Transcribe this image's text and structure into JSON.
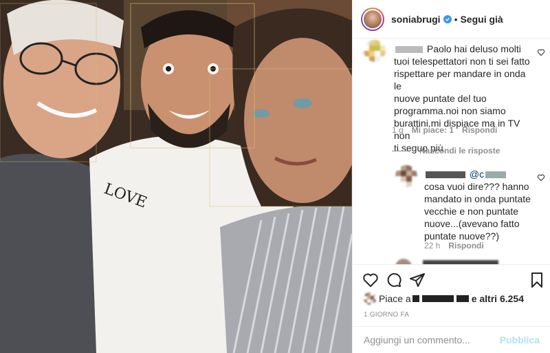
{
  "post": {
    "username": "soniabrugi",
    "follow_label": "Segui già",
    "separator": "•"
  },
  "comments": [
    {
      "text_line1": "Paolo hai deluso molti",
      "text_lines": [
        "tuoi telespettatori non ti sei fatto",
        "rispettare per mandare in onda le",
        "nuove puntate del tuo",
        "programma.noi non siamo",
        "burattini.mi dispiace ma in TV non",
        "ti seguo più"
      ],
      "time": "1 g",
      "likes": "Mi piace: 1",
      "reply": "Rispondi"
    }
  ],
  "hide_replies": "Nascondi le risposte",
  "reply": {
    "mention": "@c",
    "text_lines": [
      "cosa vuoi dire??? hanno",
      "mandato in onda puntate",
      "vecchie e non puntate",
      "nuove...(avevano fatto",
      "puntate nuove??)"
    ],
    "time": "22 h",
    "reply_label": "Rispondi"
  },
  "likes": {
    "prefix": "Piace a",
    "and_others": "e altri 6.254",
    "count": "6.254"
  },
  "date": "1 GIORNO FA",
  "add_comment": {
    "placeholder": "Aggiungi un commento...",
    "publish": "Pubblica"
  },
  "colors": {
    "accent_blue": "#3897f0",
    "publish_disabled": "#b2dffc",
    "meta_gray": "#8e8e8e"
  }
}
